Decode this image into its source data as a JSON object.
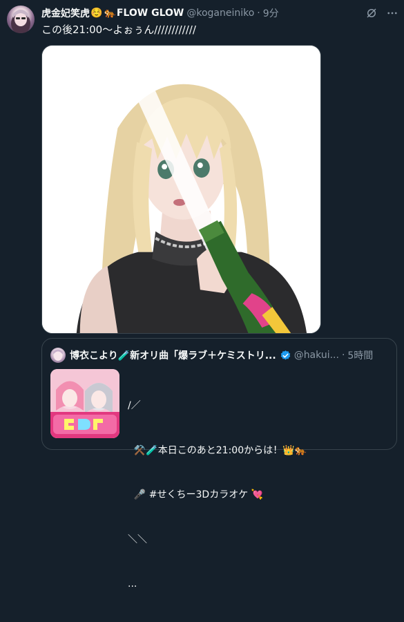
{
  "tweet": {
    "display_name": "虎金妃笑虎",
    "name_emoji_1": "☺️",
    "name_emoji_2": "🐅",
    "name_suffix": "FLOW GLOW",
    "handle": "@koganeiniko",
    "separator": "·",
    "time": "9分",
    "text": "この後21:00～よぉぅん////////////",
    "icons": {
      "grok": "grok-icon",
      "more": "more-icon"
    }
  },
  "quote": {
    "display_name": "博衣こより🧪新オリ曲「爆ラブ＋ケミストリ...",
    "handle": "@hakui...",
    "separator": "·",
    "time": "5時間",
    "verified_color": "#1d9bf0",
    "lines": [
      "/／",
      "  ⚒️🧪本日このあと21:00からは！👑🐅",
      "  🎤 #せくちー3Dカラオケ 💘",
      "＼＼",
      "..."
    ]
  },
  "colors": {
    "background": "#15202b",
    "text": "#f7f9f9",
    "muted": "#8b98a5",
    "border": "#38444d"
  }
}
